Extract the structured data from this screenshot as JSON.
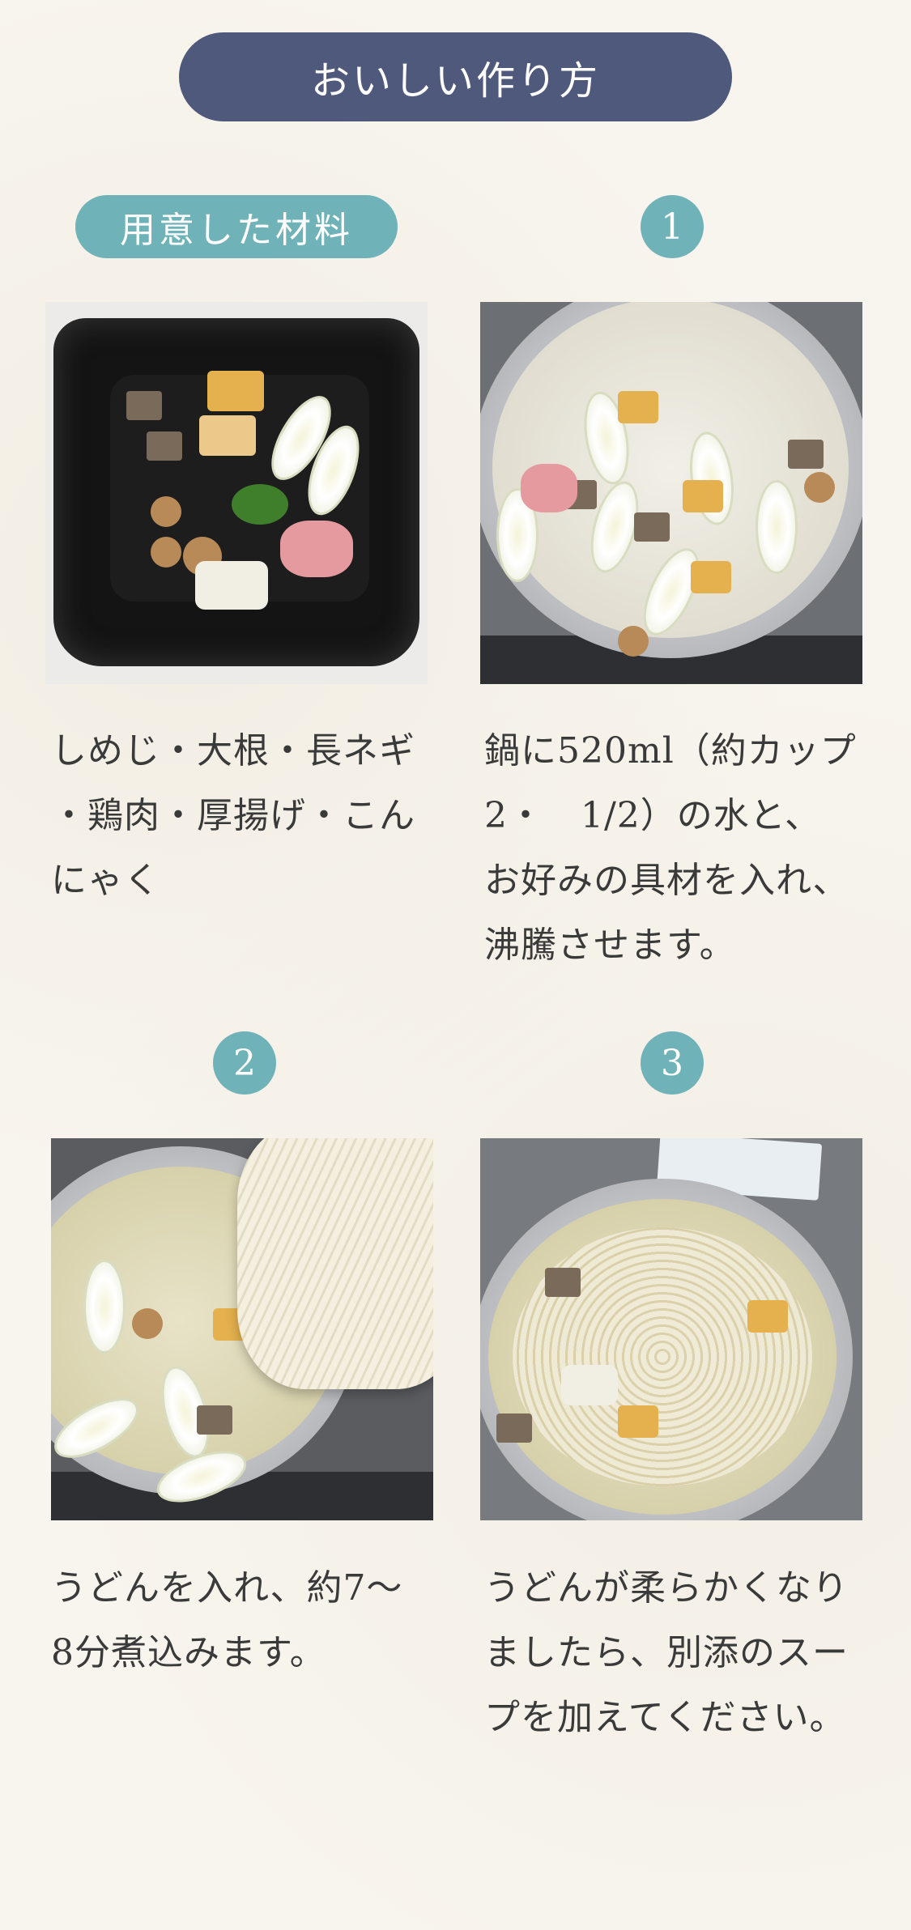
{
  "header": {
    "title": "おいしい作り方"
  },
  "ingredients": {
    "label": "用意した材料",
    "caption": "しめじ・大根・長ネギ\n・鶏肉・厚揚げ・こん\nにゃく",
    "photo_icon": "ingredients-bowl-photo"
  },
  "steps": [
    {
      "number": "1",
      "caption": "鍋に520ml（約カップ\n2・　1/2）の水と、\nお好みの具材を入れ、\n沸騰させます。",
      "photo_icon": "pot-boiling-photo"
    },
    {
      "number": "2",
      "caption": "うどんを入れ、約7〜\n8分煮込みます。",
      "photo_icon": "adding-udon-photo"
    },
    {
      "number": "3",
      "caption": "うどんが柔らかくなり\nましたら、別添のスー\nプを加えてください。",
      "photo_icon": "adding-soup-photo"
    }
  ],
  "colors": {
    "title_bg": "#4f597c",
    "accent": "#6fb3b9",
    "page_bg": "#f8f5ee",
    "text": "#3a3a3a"
  }
}
